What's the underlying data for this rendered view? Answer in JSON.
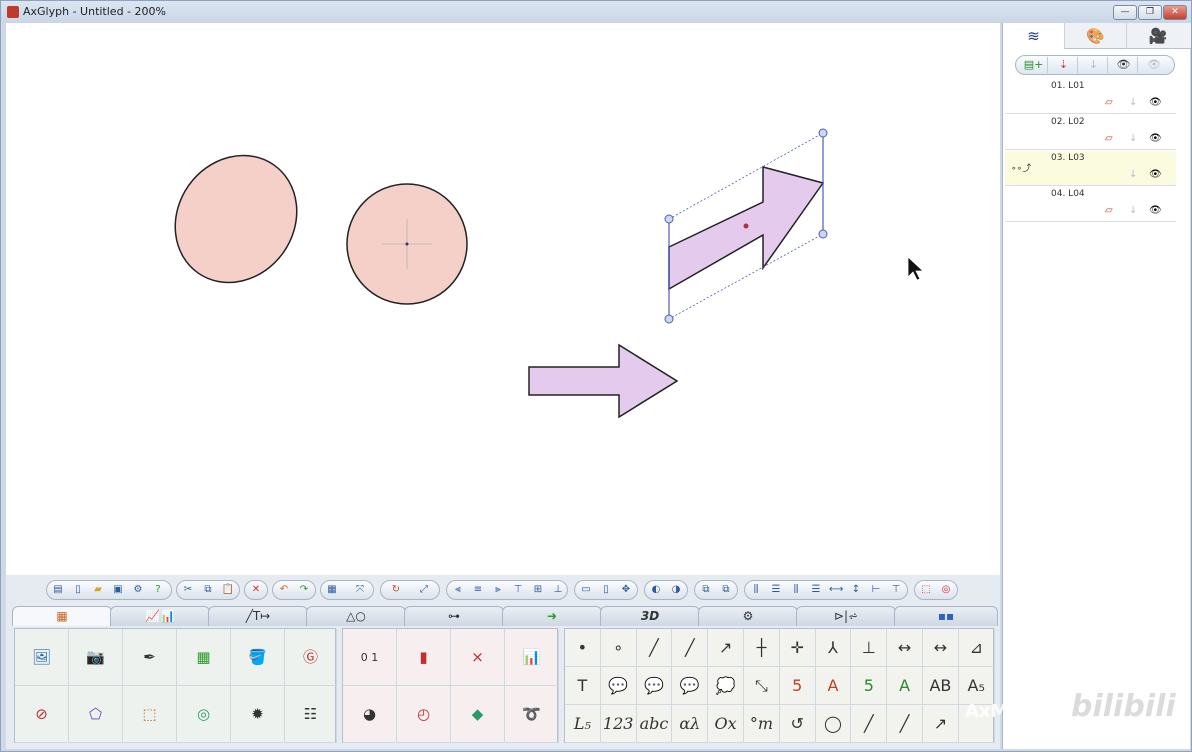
{
  "window": {
    "title": "AxGlyph - Untitled - 200%"
  },
  "right_panel": {
    "tabs": [
      {
        "icon": "layers-icon",
        "glyph": "≋"
      },
      {
        "icon": "palette-icon",
        "glyph": "🎨"
      },
      {
        "icon": "camera-icon",
        "glyph": "🎥"
      }
    ],
    "layer_tools": [
      "add-layer-icon",
      "move-down-icon",
      "move-down-disabled-icon",
      "show-icon",
      "hide-icon"
    ],
    "layers": [
      {
        "name": "01. L01",
        "selected": false
      },
      {
        "name": "02. L02",
        "selected": false
      },
      {
        "name": "03. L03",
        "selected": true
      },
      {
        "name": "04. L04",
        "selected": false
      }
    ]
  },
  "bottom_tabs": [
    {
      "icon": "colors-tab-icon",
      "label": "▦"
    },
    {
      "icon": "chart-tab-icon",
      "label": "📈📊"
    },
    {
      "icon": "line-text-tab-icon",
      "label": "╱T↦"
    },
    {
      "icon": "shapes-tab-icon",
      "label": "△○"
    },
    {
      "icon": "flow-tab-icon",
      "label": "⊶"
    },
    {
      "icon": "arrow-tab-icon",
      "label": "➜"
    },
    {
      "icon": "3d-tab-icon",
      "label": "3D"
    },
    {
      "icon": "circuit-tab-icon",
      "label": "⚙"
    },
    {
      "icon": "diode-tab-icon",
      "label": "⊳|⩫"
    },
    {
      "icon": "misc-tab-icon",
      "label": "▪▪"
    }
  ],
  "panel_text_row1": [
    "•",
    "∘",
    "╱",
    "╱",
    "↗",
    "┼",
    "✛",
    "⅄",
    "⊥",
    "↔",
    "↔",
    "⊿"
  ],
  "panel_text_row2": [
    "T",
    "💬",
    "💬",
    "💬",
    "💭",
    "⤡",
    "5",
    "A",
    "5",
    "A",
    "AB",
    "A₅"
  ],
  "panel_text_row3": [
    "L₅",
    "123",
    "abc",
    "αλ",
    "Ox",
    "°m",
    "↺",
    "◯",
    "╱",
    "╱",
    "↗",
    ""
  ],
  "watermark": {
    "text1": "AxMath",
    "text2": "bilibili"
  }
}
